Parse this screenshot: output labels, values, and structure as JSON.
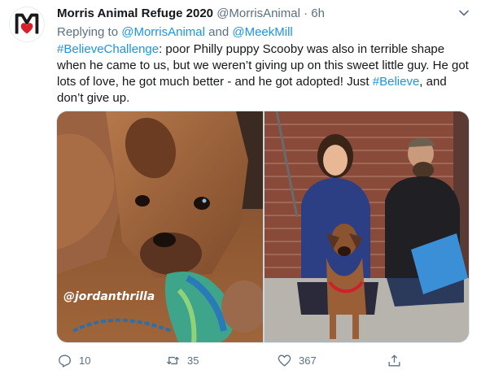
{
  "tweet": {
    "display_name": "Morris Animal Refuge 2020",
    "handle": "@MorrisAnimal",
    "separator": " · ",
    "time": "6h",
    "replying_prefix": "Replying to ",
    "reply_handle_1": "@MorrisAnimal",
    "reply_and": " and ",
    "reply_handle_2": "@MeekMill",
    "body_hashtag_1": "#BelieveChallenge",
    "body_part_1": ": poor Philly puppy Scooby was also in terrible shape when he came to us, but we weren’t giving up on this sweet little guy. He got lots of love, he got much better - and he got adopted! Just ",
    "body_hashtag_2": "#Believe",
    "body_part_2": ", and don’t give up.",
    "photo_watermark": "@jordanthrilla"
  },
  "actions": {
    "reply_count": "10",
    "retweet_count": "35",
    "like_count": "367"
  },
  "colors": {
    "link": "#1b95e0",
    "secondary_text": "#5b7083",
    "brand_red": "#d6212a"
  },
  "icons": {
    "avatar": "morris-animal-refuge-logo",
    "caret": "chevron-down-icon",
    "reply": "reply-icon",
    "retweet": "retweet-icon",
    "like": "heart-icon",
    "share": "share-icon"
  }
}
